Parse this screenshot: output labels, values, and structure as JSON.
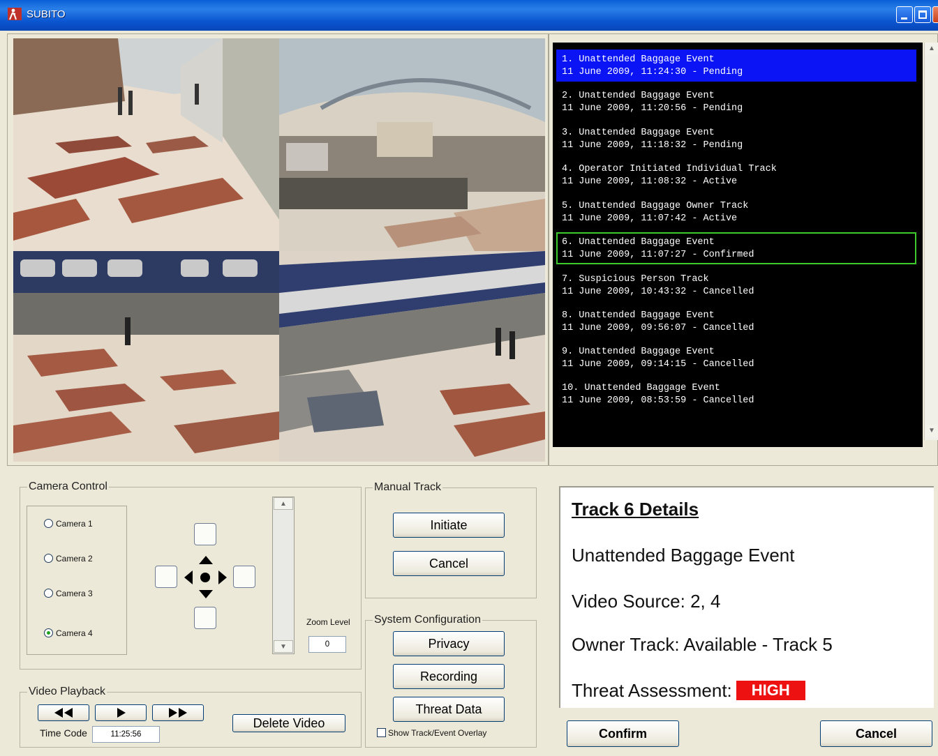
{
  "window": {
    "title": "SUBITO",
    "app_icon": "person-walking-icon"
  },
  "events": [
    {
      "title": "1. Unattended Baggage Event",
      "detail": "11 June 2009, 11:24:30 - Pending"
    },
    {
      "title": "2. Unattended Baggage Event",
      "detail": "11 June 2009, 11:20:56 - Pending"
    },
    {
      "title": "3. Unattended Baggage Event",
      "detail": "11 June 2009, 11:18:32 - Pending"
    },
    {
      "title": "4. Operator Initiated Individual Track",
      "detail": "11 June 2009, 11:08:32 - Active"
    },
    {
      "title": "5. Unattended Baggage Owner Track",
      "detail": "11 June 2009, 11:07:42 - Active"
    },
    {
      "title": "6. Unattended Baggage Event",
      "detail": "11 June 2009, 11:07:27 - Confirmed"
    },
    {
      "title": "7. Suspicious Person Track",
      "detail": "11 June 2009, 10:43:32 - Cancelled"
    },
    {
      "title": "8. Unattended Baggage Event",
      "detail": "11 June 2009, 09:56:07 - Cancelled"
    },
    {
      "title": "9. Unattended Baggage Event",
      "detail": "11 June 2009, 09:14:15 - Cancelled"
    },
    {
      "title": "10. Unattended Baggage Event",
      "detail": "11 June 2009, 08:53:59 - Cancelled"
    }
  ],
  "camera_control": {
    "title": "Camera Control",
    "cameras": [
      "Camera 1",
      "Camera 2",
      "Camera 3",
      "Camera 4"
    ],
    "selected_camera": "Camera 4",
    "zoom_label": "Zoom Level",
    "zoom_value": "0"
  },
  "manual_track": {
    "title": "Manual Track",
    "initiate": "Initiate",
    "cancel": "Cancel"
  },
  "system_config": {
    "title": "System Configuration",
    "privacy": "Privacy",
    "recording": "Recording",
    "threat_data": "Threat Data",
    "overlay_label": "Show Track/Event Overlay"
  },
  "video_playback": {
    "title": "Video Playback",
    "time_code_label": "Time Code",
    "time_code": "11:25:56",
    "delete": "Delete Video"
  },
  "details": {
    "title": "Track 6 Details",
    "event_type": "Unattended Baggage Event",
    "video_source": "Video Source: 2, 4",
    "owner_track": "Owner Track: Available - Track 5",
    "threat_label": "Threat Assessment:",
    "threat_level": "HIGH",
    "threat_color": "#ee1111"
  },
  "actions": {
    "confirm": "Confirm",
    "cancel": "Cancel"
  },
  "colors": {
    "selected_event": "#0a14f5",
    "confirmed_border": "#3ccb2b"
  }
}
